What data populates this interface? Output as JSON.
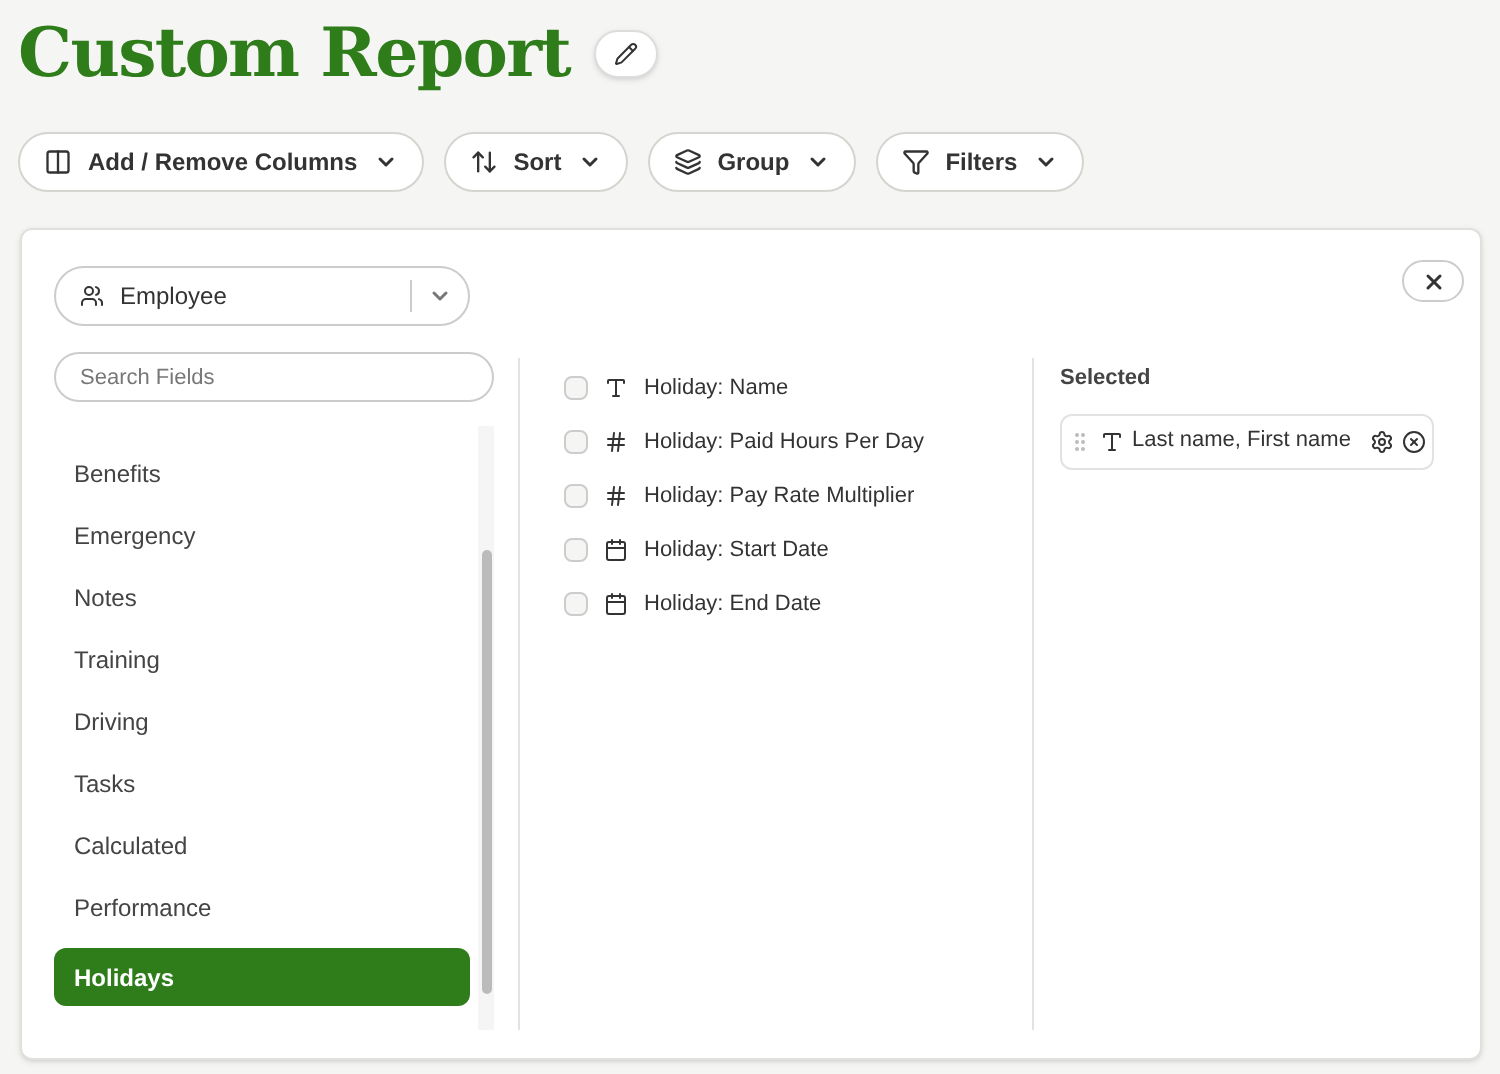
{
  "title": "Custom Report",
  "toolbar": [
    {
      "kind": "columns",
      "label": "Add / Remove Columns"
    },
    {
      "kind": "sort",
      "label": "Sort"
    },
    {
      "kind": "group",
      "label": "Group"
    },
    {
      "kind": "filter",
      "label": "Filters"
    }
  ],
  "entity_select": {
    "value": "Employee"
  },
  "search": {
    "placeholder": "Search Fields"
  },
  "categories": [
    {
      "label": "Benefits",
      "selected": false
    },
    {
      "label": "Emergency",
      "selected": false
    },
    {
      "label": "Notes",
      "selected": false
    },
    {
      "label": "Training",
      "selected": false
    },
    {
      "label": "Driving",
      "selected": false
    },
    {
      "label": "Tasks",
      "selected": false
    },
    {
      "label": "Calculated",
      "selected": false
    },
    {
      "label": "Performance",
      "selected": false
    },
    {
      "label": "Holidays",
      "selected": true
    }
  ],
  "fields": [
    {
      "kind": "text",
      "label": "Holiday: Name",
      "checked": false
    },
    {
      "kind": "number",
      "label": "Holiday: Paid Hours Per Day",
      "checked": false
    },
    {
      "kind": "number",
      "label": "Holiday: Pay Rate Multiplier",
      "checked": false
    },
    {
      "kind": "date",
      "label": "Holiday: Start Date",
      "checked": false
    },
    {
      "kind": "date",
      "label": "Holiday: End Date",
      "checked": false
    }
  ],
  "selected_heading": "Selected",
  "selected_columns": [
    {
      "kind": "text",
      "label": "Last name, First name"
    }
  ]
}
